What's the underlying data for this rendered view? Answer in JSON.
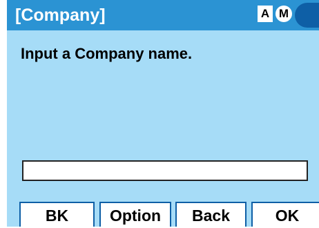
{
  "header": {
    "title": "[Company]",
    "mode_a": "A",
    "mode_m": "M"
  },
  "prompt": "Input a Company name.",
  "input": {
    "value": "",
    "placeholder": ""
  },
  "softkeys": [
    {
      "label": "BK"
    },
    {
      "label": "Option"
    },
    {
      "label": "Back"
    },
    {
      "label": "OK"
    }
  ],
  "colors": {
    "screen_background": "#a6dcf7",
    "title_bar": "#2b93d3",
    "accent_dark": "#0e5fa6"
  }
}
